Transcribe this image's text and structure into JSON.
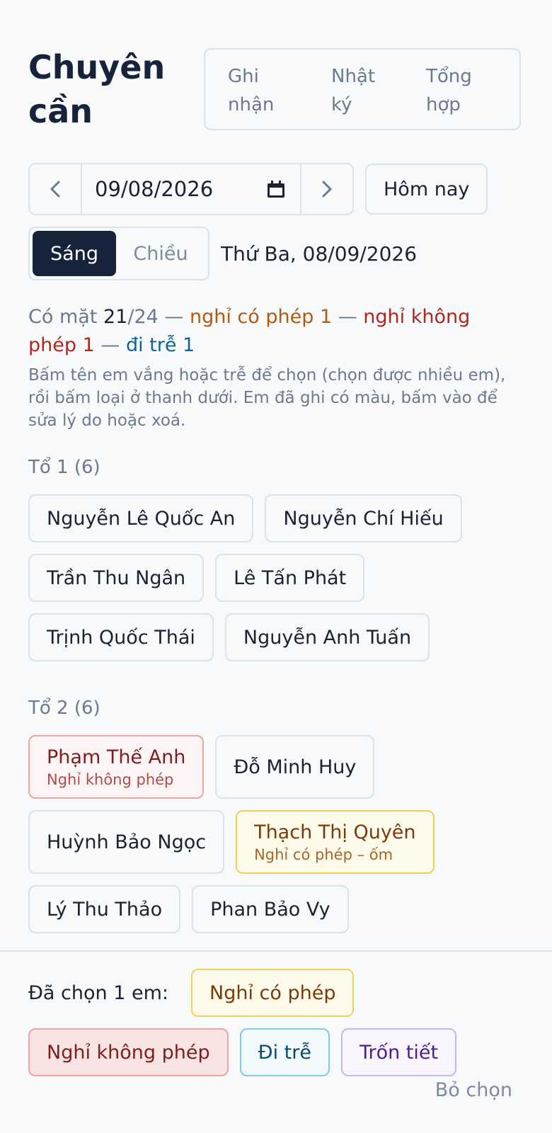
{
  "header": {
    "title_line1": "Chuyên",
    "title_line2": "cần",
    "tabs": [
      {
        "line1": "Ghi",
        "line2": "nhận"
      },
      {
        "line1": "Nhật",
        "line2": "ký"
      },
      {
        "line1": "Tổng",
        "line2": "hợp"
      }
    ]
  },
  "date_bar": {
    "prev_icon": "chevron-left-icon",
    "next_icon": "chevron-right-icon",
    "date_value": "09/08/2026",
    "today_label": "Hôm nay"
  },
  "session": {
    "morning_label": "Sáng",
    "afternoon_label": "Chiều",
    "selected": "Sáng",
    "day_label": "Thứ Ba, 08/09/2026"
  },
  "summary": {
    "present_prefix": "Có mặt ",
    "present_count": "21",
    "present_total": "/24",
    "sep": " — ",
    "excused": "nghỉ có phép 1",
    "unexcused": "nghỉ không phép 1",
    "late": "đi trễ 1",
    "hint": "Bấm tên em vắng hoặc trễ để chọn (chọn được nhiều em), rồi bấm loại ở thanh dưới. Em đã ghi có màu, bấm vào để sửa lý do hoặc xoá."
  },
  "groups": [
    {
      "title": "Tổ 1 (6)",
      "students": [
        {
          "name": "Nguyễn Lê Quốc An"
        },
        {
          "name": "Nguyễn Chí Hiếu"
        },
        {
          "name": "Trần Thu Ngân"
        },
        {
          "name": "Lê Tấn Phát"
        },
        {
          "name": "Trịnh Quốc Thái"
        },
        {
          "name": "Nguyễn Anh Tuấn"
        }
      ]
    },
    {
      "title": "Tổ 2 (6)",
      "students": [
        {
          "name": "Phạm Thế Anh",
          "status": "Nghỉ không phép"
        },
        {
          "name": "Đỗ Minh Huy"
        },
        {
          "name": "Huỳnh Bảo Ngọc"
        },
        {
          "name": "Thạch Thị Quyên",
          "status": "Nghỉ có phép – ốm"
        },
        {
          "name": "Lý Thu Thảo"
        },
        {
          "name": "Phan Bảo Vy"
        }
      ]
    }
  ],
  "bottom_bar": {
    "selected_label": "Đã chọn 1 em:",
    "excused_btn": "Nghỉ có phép",
    "unexcused_btn": "Nghỉ không phép",
    "late_btn": "Đi trễ",
    "skip_btn": "Trốn tiết",
    "deselect": "Bỏ chọn"
  },
  "colors": {
    "dark": "#16233a",
    "excused": "#b45a0f",
    "unexcused": "#b3261e",
    "late": "#0e6496",
    "skip": "#4c1d95"
  }
}
